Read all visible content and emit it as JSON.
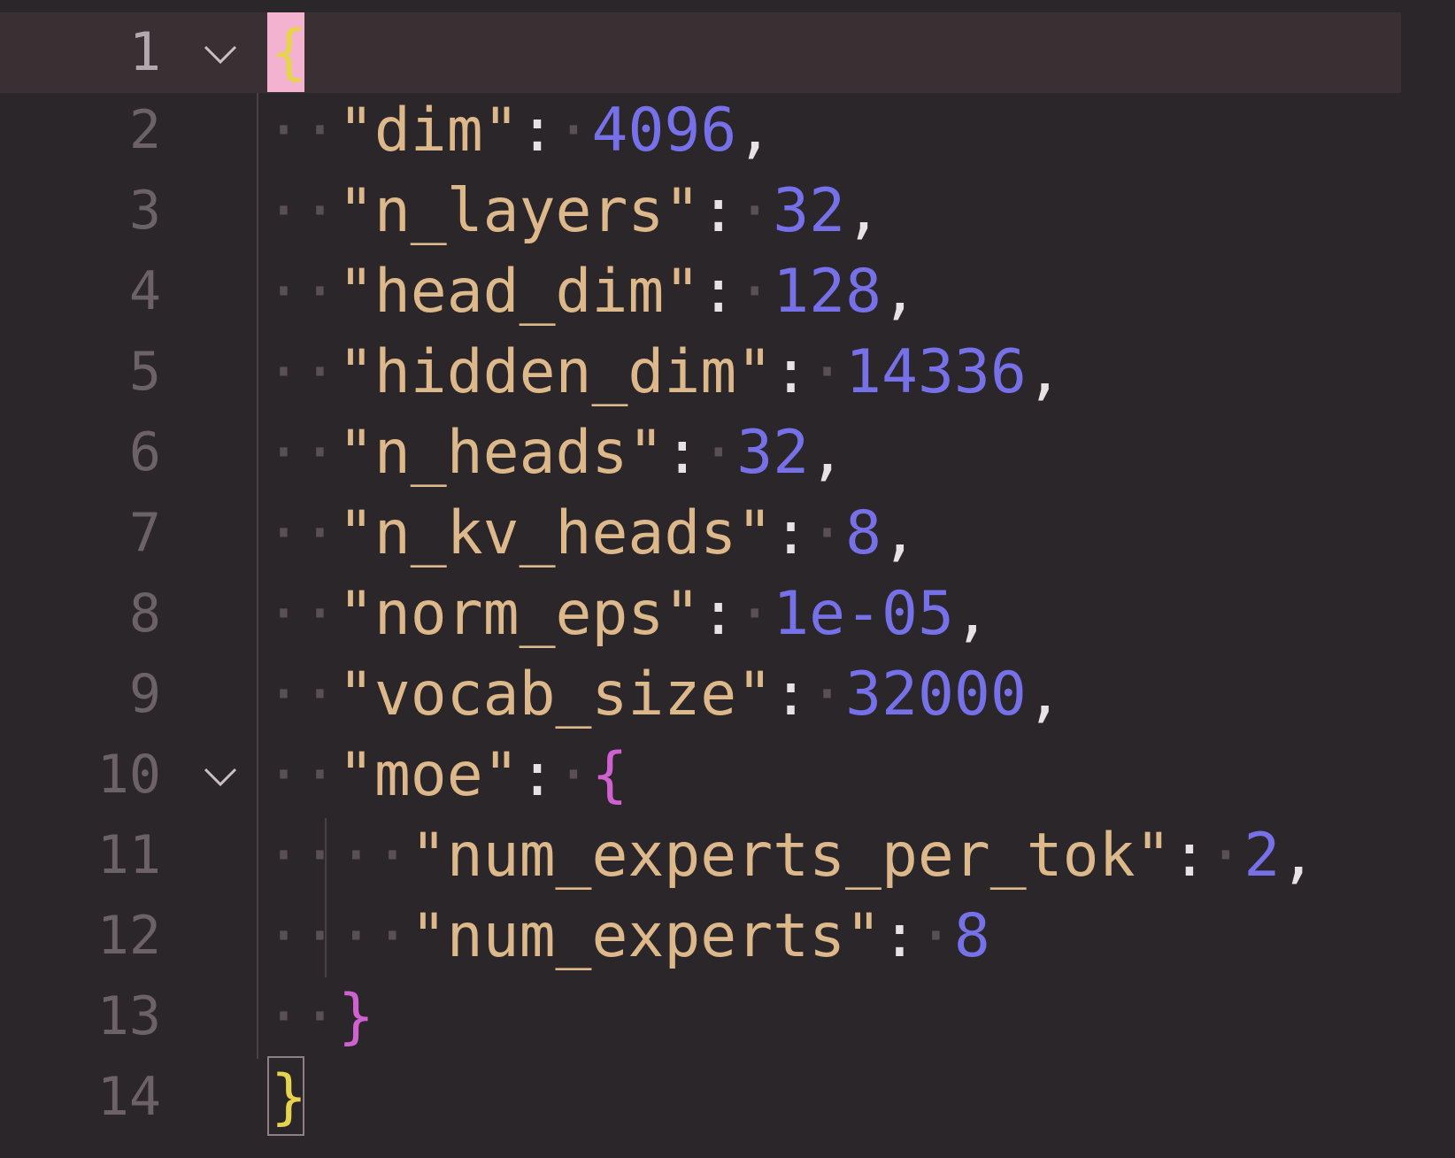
{
  "editor": {
    "language": "json",
    "active_line": 1,
    "colors": {
      "background": "#2b2629",
      "current_line": "#3a2f33",
      "key": "#ddb88a",
      "number": "#7671e9",
      "brace_outer": "#e6d44f",
      "brace_inner": "#cf62d0",
      "line_number": "#6c6166"
    },
    "lines": [
      {
        "number": "1",
        "text": "{"
      },
      {
        "number": "2",
        "key": "\"dim\"",
        "value": "4096",
        "trail": ","
      },
      {
        "number": "3",
        "key": "\"n_layers\"",
        "value": "32",
        "trail": ","
      },
      {
        "number": "4",
        "key": "\"head_dim\"",
        "value": "128",
        "trail": ","
      },
      {
        "number": "5",
        "key": "\"hidden_dim\"",
        "value": "14336",
        "trail": ","
      },
      {
        "number": "6",
        "key": "\"n_heads\"",
        "value": "32",
        "trail": ","
      },
      {
        "number": "7",
        "key": "\"n_kv_heads\"",
        "value": "8",
        "trail": ","
      },
      {
        "number": "8",
        "key": "\"norm_eps\"",
        "value": "1e-05",
        "trail": ","
      },
      {
        "number": "9",
        "key": "\"vocab_size\"",
        "value": "32000",
        "trail": ","
      },
      {
        "number": "10",
        "key": "\"moe\"",
        "value": "{"
      },
      {
        "number": "11",
        "key": "\"num_experts_per_tok\"",
        "value": "2",
        "trail": ","
      },
      {
        "number": "12",
        "key": "\"num_experts\"",
        "value": "8"
      },
      {
        "number": "13",
        "text": "}"
      },
      {
        "number": "14",
        "text": "}"
      }
    ],
    "fold_icons": [
      "chevron-down-icon",
      "chevron-down-icon"
    ]
  }
}
